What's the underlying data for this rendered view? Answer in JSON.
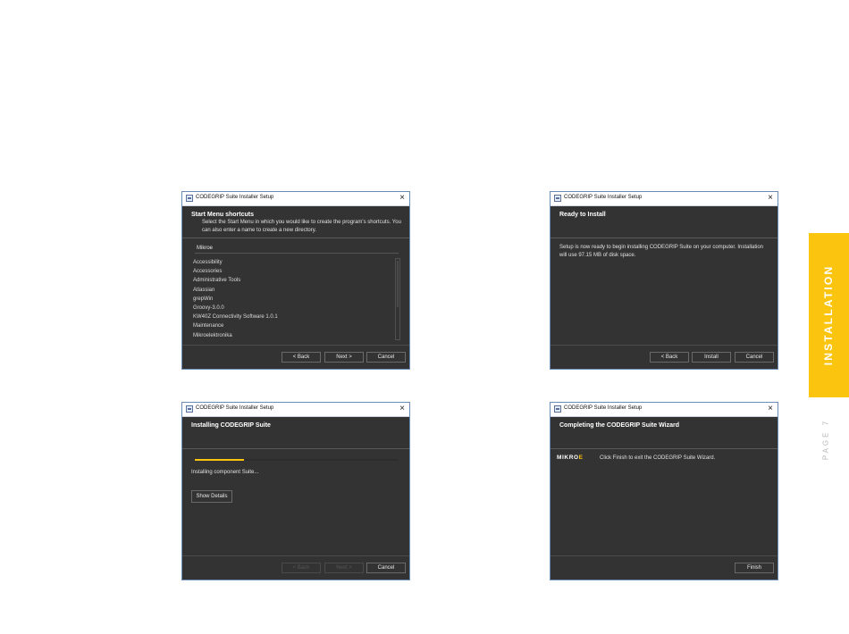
{
  "side_tab": {
    "label": "INSTALLATION",
    "color": "#fbc40f"
  },
  "page_number": "PAGE 7",
  "window_title": "CODEGRIP Suite Installer Setup",
  "close_glyph": "×",
  "windows": {
    "start_menu": {
      "heading": "Start Menu shortcuts",
      "subheading": "Select the Start Menu in which you would like to create the program's shortcuts. You can also enter a name to create a new directory.",
      "folder_value": "Mikroe",
      "folders": [
        "Accessibility",
        "Accessories",
        "Administrative Tools",
        "Atlassian",
        "grepWin",
        "Groovy-3.0.0",
        "KW40Z Connectivity Software 1.0.1",
        "Maintenance",
        "Mikroelektronika"
      ],
      "buttons": {
        "back": "< Back",
        "next": "Next >",
        "cancel": "Cancel"
      }
    },
    "ready": {
      "heading": "Ready to Install",
      "body": "Setup is now ready to begin installing CODEGRIP Suite on your computer. Installation will use 97.15 MB of disk space.",
      "buttons": {
        "back": "< Back",
        "install": "Install",
        "cancel": "Cancel"
      }
    },
    "installing": {
      "heading": "Installing CODEGRIP Suite",
      "progress": 0.24,
      "status": "Installing component Suite...",
      "details_button": "Show Details",
      "buttons": {
        "back": "< Back",
        "next": "Next >",
        "cancel": "Cancel"
      }
    },
    "completing": {
      "heading": "Completing the CODEGRIP Suite Wizard",
      "logo_text": "MIKRO",
      "logo_accent": "E",
      "message": "Click Finish to exit the CODEGRIP Suite Wizard.",
      "buttons": {
        "finish": "Finish"
      }
    }
  }
}
